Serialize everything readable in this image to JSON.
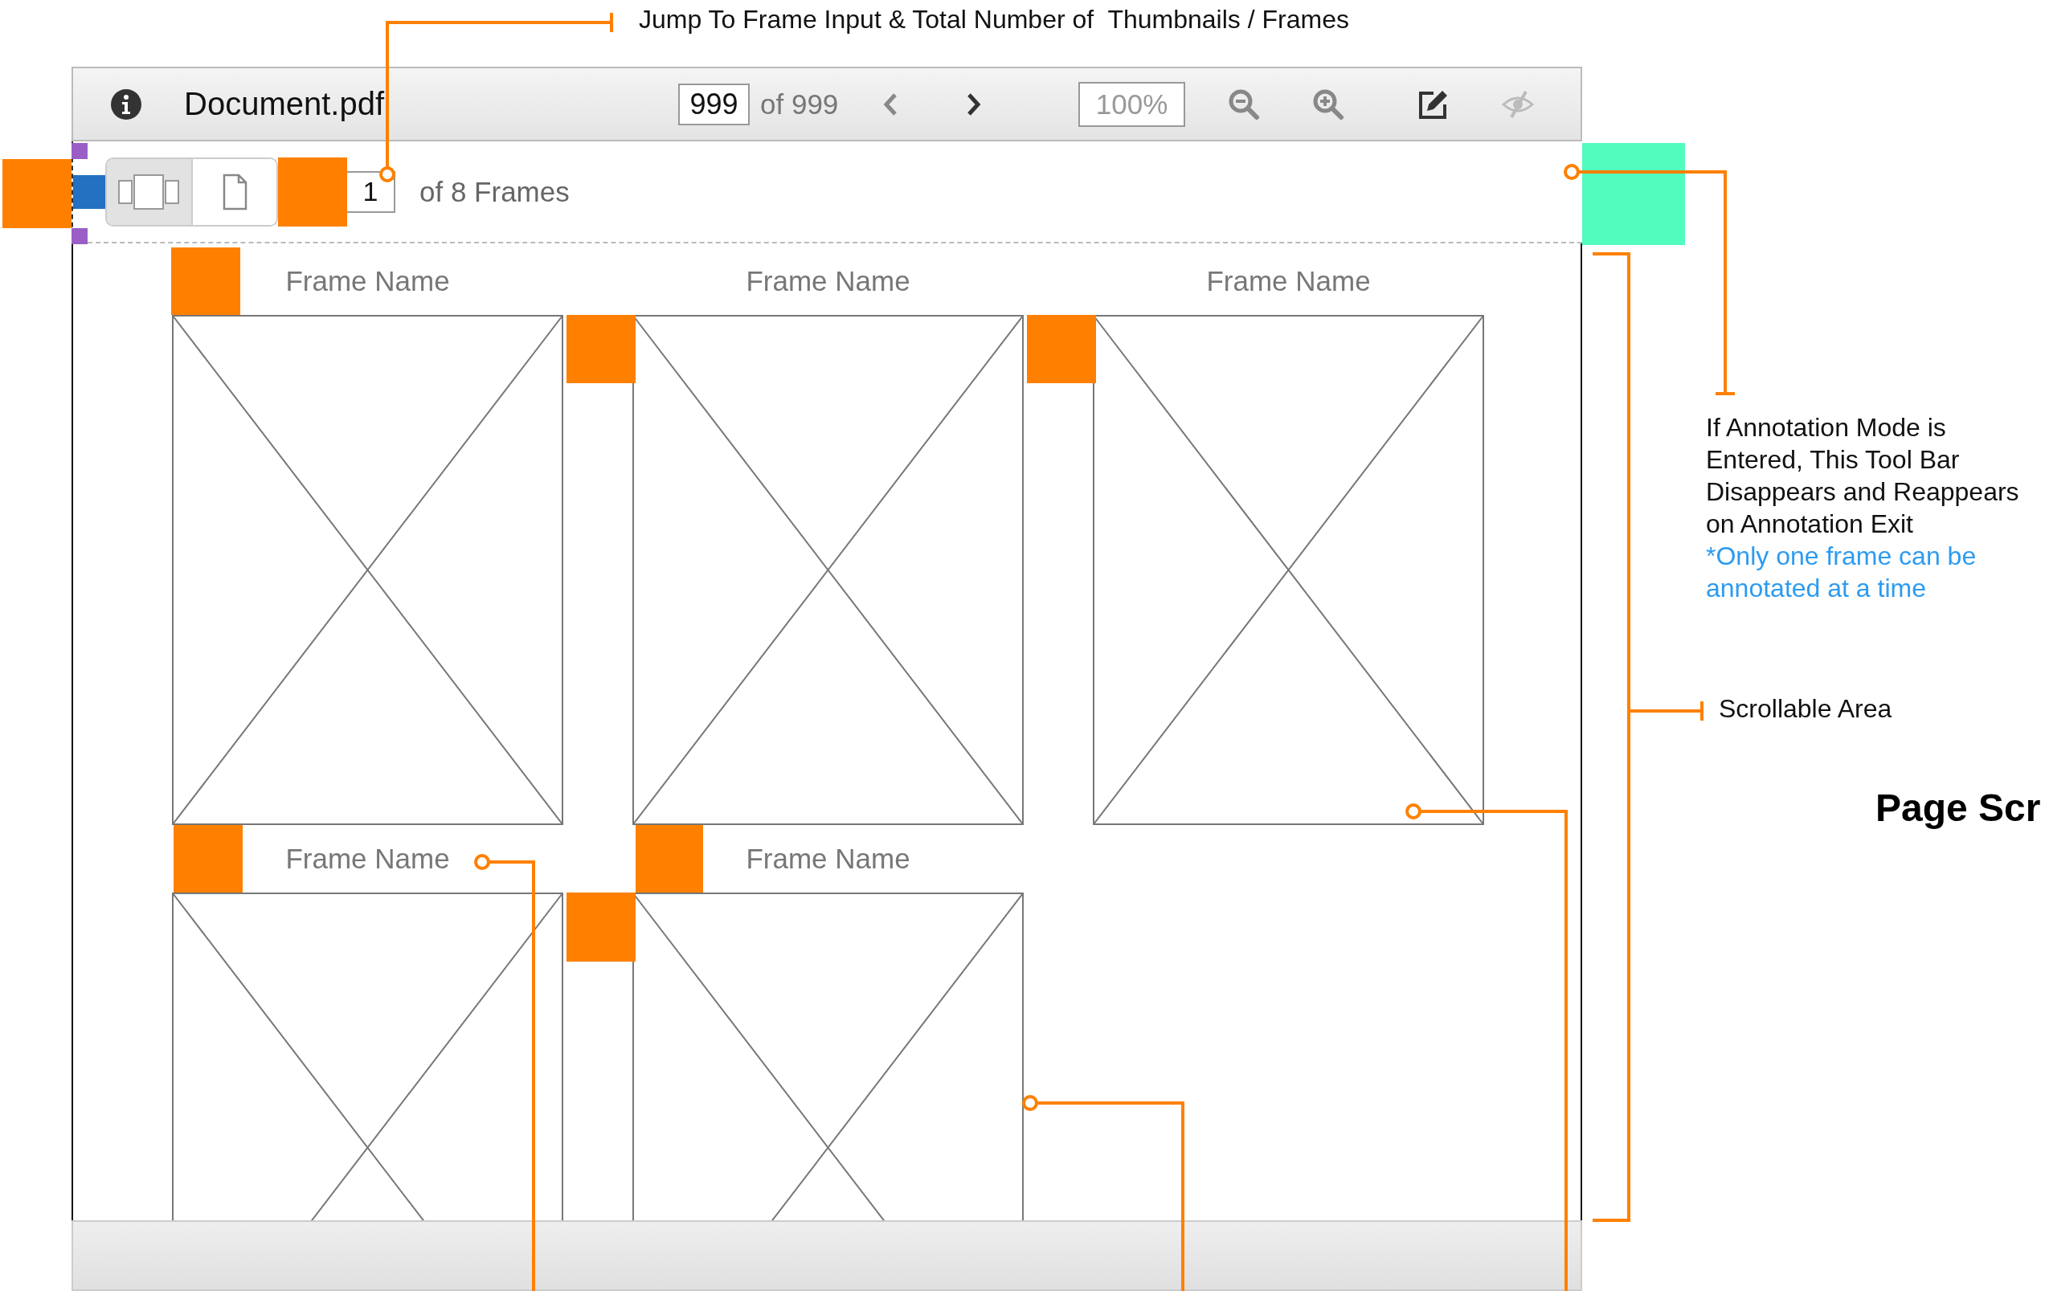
{
  "toolbar": {
    "file_name": "Document.pdf",
    "page_input": "999",
    "page_total": "of 999",
    "zoom": "100%"
  },
  "frame_bar": {
    "view_modes": [
      {
        "kind": "thumbnails",
        "selected": true
      },
      {
        "kind": "page",
        "selected": false
      }
    ],
    "frame_input": "1",
    "frame_total": "of 8 Frames"
  },
  "frames": [
    {
      "name": "Frame Name"
    },
    {
      "name": "Frame Name"
    },
    {
      "name": "Frame Name"
    },
    {
      "name": "Frame Name"
    },
    {
      "name": "Frame Name"
    }
  ],
  "annotations": {
    "jump_to_frame": "Jump To Frame Input & Total Number of  Thumbnails / Frames",
    "annotation_mode": "If Annotation Mode is Entered, This Tool Bar Disappears and Reappears on Annotation Exit",
    "annotation_note": "*Only one frame can be annotated at a time",
    "scrollable_area": "Scrollable Area",
    "page_title": "Page Scr"
  }
}
